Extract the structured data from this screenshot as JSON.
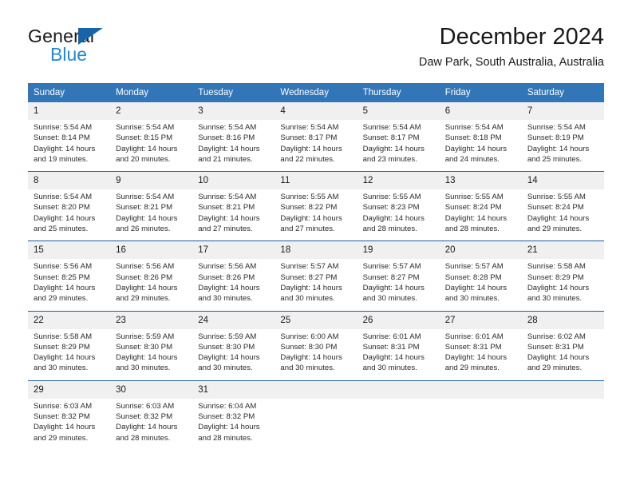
{
  "brand": {
    "name_dark": "General",
    "name_blue": "Blue",
    "accent_blue": "#2387d6",
    "triangle_blue": "#1565a8"
  },
  "header": {
    "title": "December 2024",
    "subtitle": "Daw Park, South Australia, Australia"
  },
  "colors": {
    "header_row_bg": "#3276b8",
    "header_row_text": "#ffffff",
    "week_separator": "#1f5e9e",
    "daynum_band_bg": "#f0f0f0",
    "body_text": "#2b2b2b"
  },
  "weekday_headers": [
    "Sunday",
    "Monday",
    "Tuesday",
    "Wednesday",
    "Thursday",
    "Friday",
    "Saturday"
  ],
  "weeks": [
    {
      "days": [
        {
          "num": "1",
          "sunrise": "Sunrise: 5:54 AM",
          "sunset": "Sunset: 8:14 PM",
          "daylight1": "Daylight: 14 hours",
          "daylight2": "and 19 minutes."
        },
        {
          "num": "2",
          "sunrise": "Sunrise: 5:54 AM",
          "sunset": "Sunset: 8:15 PM",
          "daylight1": "Daylight: 14 hours",
          "daylight2": "and 20 minutes."
        },
        {
          "num": "3",
          "sunrise": "Sunrise: 5:54 AM",
          "sunset": "Sunset: 8:16 PM",
          "daylight1": "Daylight: 14 hours",
          "daylight2": "and 21 minutes."
        },
        {
          "num": "4",
          "sunrise": "Sunrise: 5:54 AM",
          "sunset": "Sunset: 8:17 PM",
          "daylight1": "Daylight: 14 hours",
          "daylight2": "and 22 minutes."
        },
        {
          "num": "5",
          "sunrise": "Sunrise: 5:54 AM",
          "sunset": "Sunset: 8:17 PM",
          "daylight1": "Daylight: 14 hours",
          "daylight2": "and 23 minutes."
        },
        {
          "num": "6",
          "sunrise": "Sunrise: 5:54 AM",
          "sunset": "Sunset: 8:18 PM",
          "daylight1": "Daylight: 14 hours",
          "daylight2": "and 24 minutes."
        },
        {
          "num": "7",
          "sunrise": "Sunrise: 5:54 AM",
          "sunset": "Sunset: 8:19 PM",
          "daylight1": "Daylight: 14 hours",
          "daylight2": "and 25 minutes."
        }
      ]
    },
    {
      "days": [
        {
          "num": "8",
          "sunrise": "Sunrise: 5:54 AM",
          "sunset": "Sunset: 8:20 PM",
          "daylight1": "Daylight: 14 hours",
          "daylight2": "and 25 minutes."
        },
        {
          "num": "9",
          "sunrise": "Sunrise: 5:54 AM",
          "sunset": "Sunset: 8:21 PM",
          "daylight1": "Daylight: 14 hours",
          "daylight2": "and 26 minutes."
        },
        {
          "num": "10",
          "sunrise": "Sunrise: 5:54 AM",
          "sunset": "Sunset: 8:21 PM",
          "daylight1": "Daylight: 14 hours",
          "daylight2": "and 27 minutes."
        },
        {
          "num": "11",
          "sunrise": "Sunrise: 5:55 AM",
          "sunset": "Sunset: 8:22 PM",
          "daylight1": "Daylight: 14 hours",
          "daylight2": "and 27 minutes."
        },
        {
          "num": "12",
          "sunrise": "Sunrise: 5:55 AM",
          "sunset": "Sunset: 8:23 PM",
          "daylight1": "Daylight: 14 hours",
          "daylight2": "and 28 minutes."
        },
        {
          "num": "13",
          "sunrise": "Sunrise: 5:55 AM",
          "sunset": "Sunset: 8:24 PM",
          "daylight1": "Daylight: 14 hours",
          "daylight2": "and 28 minutes."
        },
        {
          "num": "14",
          "sunrise": "Sunrise: 5:55 AM",
          "sunset": "Sunset: 8:24 PM",
          "daylight1": "Daylight: 14 hours",
          "daylight2": "and 29 minutes."
        }
      ]
    },
    {
      "days": [
        {
          "num": "15",
          "sunrise": "Sunrise: 5:56 AM",
          "sunset": "Sunset: 8:25 PM",
          "daylight1": "Daylight: 14 hours",
          "daylight2": "and 29 minutes."
        },
        {
          "num": "16",
          "sunrise": "Sunrise: 5:56 AM",
          "sunset": "Sunset: 8:26 PM",
          "daylight1": "Daylight: 14 hours",
          "daylight2": "and 29 minutes."
        },
        {
          "num": "17",
          "sunrise": "Sunrise: 5:56 AM",
          "sunset": "Sunset: 8:26 PM",
          "daylight1": "Daylight: 14 hours",
          "daylight2": "and 30 minutes."
        },
        {
          "num": "18",
          "sunrise": "Sunrise: 5:57 AM",
          "sunset": "Sunset: 8:27 PM",
          "daylight1": "Daylight: 14 hours",
          "daylight2": "and 30 minutes."
        },
        {
          "num": "19",
          "sunrise": "Sunrise: 5:57 AM",
          "sunset": "Sunset: 8:27 PM",
          "daylight1": "Daylight: 14 hours",
          "daylight2": "and 30 minutes."
        },
        {
          "num": "20",
          "sunrise": "Sunrise: 5:57 AM",
          "sunset": "Sunset: 8:28 PM",
          "daylight1": "Daylight: 14 hours",
          "daylight2": "and 30 minutes."
        },
        {
          "num": "21",
          "sunrise": "Sunrise: 5:58 AM",
          "sunset": "Sunset: 8:29 PM",
          "daylight1": "Daylight: 14 hours",
          "daylight2": "and 30 minutes."
        }
      ]
    },
    {
      "days": [
        {
          "num": "22",
          "sunrise": "Sunrise: 5:58 AM",
          "sunset": "Sunset: 8:29 PM",
          "daylight1": "Daylight: 14 hours",
          "daylight2": "and 30 minutes."
        },
        {
          "num": "23",
          "sunrise": "Sunrise: 5:59 AM",
          "sunset": "Sunset: 8:30 PM",
          "daylight1": "Daylight: 14 hours",
          "daylight2": "and 30 minutes."
        },
        {
          "num": "24",
          "sunrise": "Sunrise: 5:59 AM",
          "sunset": "Sunset: 8:30 PM",
          "daylight1": "Daylight: 14 hours",
          "daylight2": "and 30 minutes."
        },
        {
          "num": "25",
          "sunrise": "Sunrise: 6:00 AM",
          "sunset": "Sunset: 8:30 PM",
          "daylight1": "Daylight: 14 hours",
          "daylight2": "and 30 minutes."
        },
        {
          "num": "26",
          "sunrise": "Sunrise: 6:01 AM",
          "sunset": "Sunset: 8:31 PM",
          "daylight1": "Daylight: 14 hours",
          "daylight2": "and 30 minutes."
        },
        {
          "num": "27",
          "sunrise": "Sunrise: 6:01 AM",
          "sunset": "Sunset: 8:31 PM",
          "daylight1": "Daylight: 14 hours",
          "daylight2": "and 29 minutes."
        },
        {
          "num": "28",
          "sunrise": "Sunrise: 6:02 AM",
          "sunset": "Sunset: 8:31 PM",
          "daylight1": "Daylight: 14 hours",
          "daylight2": "and 29 minutes."
        }
      ]
    },
    {
      "days": [
        {
          "num": "29",
          "sunrise": "Sunrise: 6:03 AM",
          "sunset": "Sunset: 8:32 PM",
          "daylight1": "Daylight: 14 hours",
          "daylight2": "and 29 minutes."
        },
        {
          "num": "30",
          "sunrise": "Sunrise: 6:03 AM",
          "sunset": "Sunset: 8:32 PM",
          "daylight1": "Daylight: 14 hours",
          "daylight2": "and 28 minutes."
        },
        {
          "num": "31",
          "sunrise": "Sunrise: 6:04 AM",
          "sunset": "Sunset: 8:32 PM",
          "daylight1": "Daylight: 14 hours",
          "daylight2": "and 28 minutes."
        },
        {
          "num": "",
          "sunrise": "",
          "sunset": "",
          "daylight1": "",
          "daylight2": ""
        },
        {
          "num": "",
          "sunrise": "",
          "sunset": "",
          "daylight1": "",
          "daylight2": ""
        },
        {
          "num": "",
          "sunrise": "",
          "sunset": "",
          "daylight1": "",
          "daylight2": ""
        },
        {
          "num": "",
          "sunrise": "",
          "sunset": "",
          "daylight1": "",
          "daylight2": ""
        }
      ]
    }
  ]
}
